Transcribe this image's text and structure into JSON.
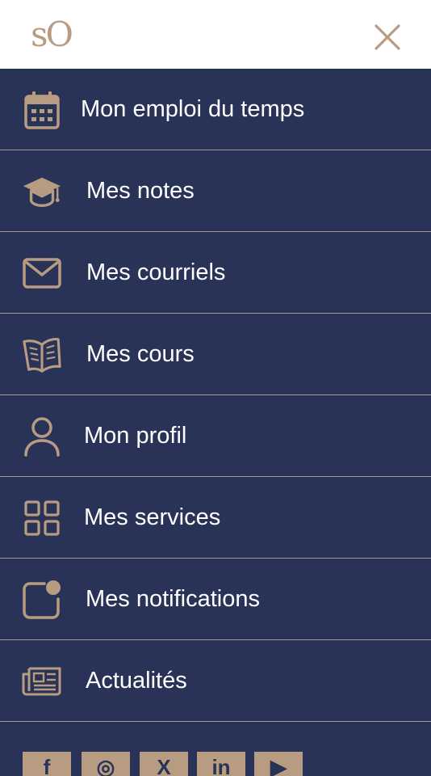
{
  "header": {
    "logo_text": "sO",
    "close_icon": "close-icon"
  },
  "menu": {
    "items": [
      {
        "label": "Mon emploi du temps",
        "icon": "calendar-icon"
      },
      {
        "label": "Mes notes",
        "icon": "graduation-cap-icon"
      },
      {
        "label": "Mes courriels",
        "icon": "envelope-icon"
      },
      {
        "label": "Mes cours",
        "icon": "open-book-icon"
      },
      {
        "label": "Mon profil",
        "icon": "user-icon"
      },
      {
        "label": "Mes services",
        "icon": "grid-icon"
      },
      {
        "label": "Mes notifications",
        "icon": "notification-icon"
      },
      {
        "label": "Actualités",
        "icon": "newspaper-icon"
      }
    ]
  },
  "social": {
    "items": [
      {
        "icon": "facebook-icon",
        "glyph": "f"
      },
      {
        "icon": "instagram-icon",
        "glyph": "◎"
      },
      {
        "icon": "x-icon",
        "glyph": "X"
      },
      {
        "icon": "linkedin-icon",
        "glyph": "in"
      },
      {
        "icon": "youtube-icon",
        "glyph": "▶"
      }
    ]
  },
  "colors": {
    "background": "#293358",
    "accent": "#b89c82",
    "divider": "#a3988f",
    "text": "#ffffff",
    "header": "#ffffff"
  }
}
